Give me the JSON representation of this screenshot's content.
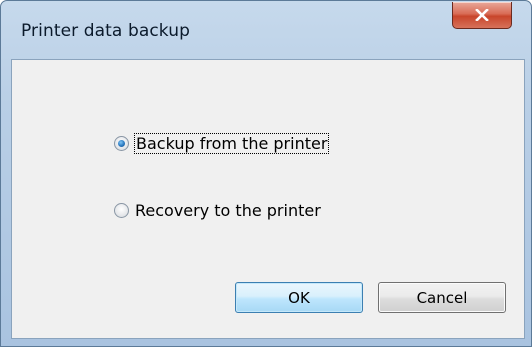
{
  "window": {
    "title": "Printer data backup",
    "close_icon": "close-icon"
  },
  "options": [
    {
      "label": "Backup from the printer",
      "selected": true
    },
    {
      "label": "Recovery to the printer",
      "selected": false
    }
  ],
  "buttons": {
    "ok_label": "OK",
    "cancel_label": "Cancel"
  },
  "colors": {
    "close_button": "#c8452b",
    "ok_border": "#3c7fb1",
    "client_bg": "#f0f0f0"
  }
}
